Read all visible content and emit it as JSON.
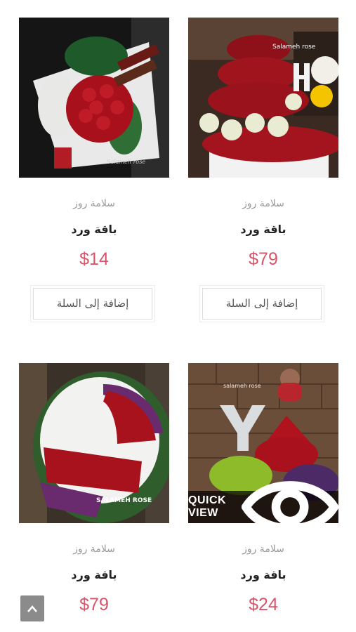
{
  "products": [
    {
      "brand": "سلامة روز",
      "title": "باقة ورد",
      "price": "$79",
      "button": "إضافة إلى السلة",
      "watermark": "Salameh rose"
    },
    {
      "brand": "سلامة روز",
      "title": "باقة ورد",
      "price": "$14",
      "button": "إضافة إلى السلة",
      "watermark": "Salameh rose"
    },
    {
      "brand": "سلامة روز",
      "title": "باقة ورد",
      "price": "$24",
      "quick_view": "QUICK VIEW",
      "watermark": "salameh rose"
    },
    {
      "brand": "سلامة روز",
      "title": "باقة ورد",
      "price": "$79",
      "watermark": "SALAMEH ROSE"
    }
  ],
  "icons": {
    "quick_view": "eye-icon",
    "scroll_top": "chevron-up-icon"
  }
}
